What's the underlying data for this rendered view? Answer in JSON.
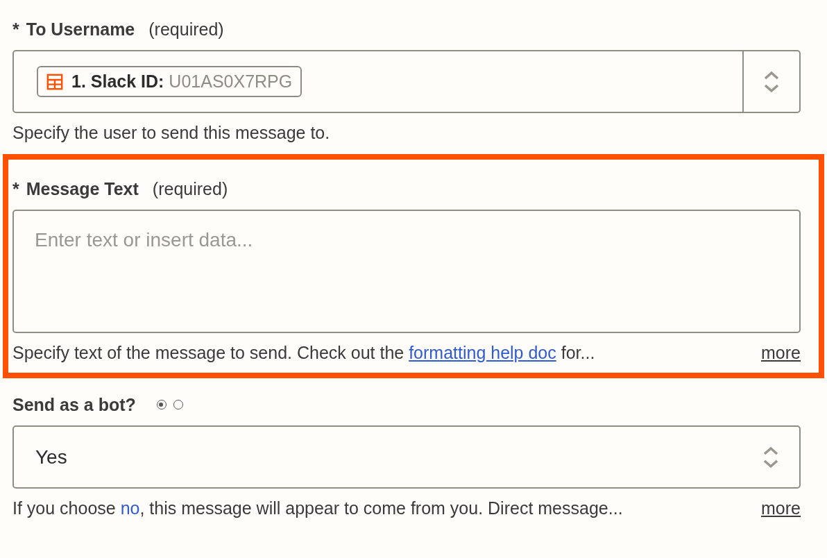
{
  "fields": [
    {
      "kind": "token-select",
      "mark": "*",
      "label": "To Username",
      "note": "(required)",
      "highlighted": false,
      "token": {
        "label": "1. Slack ID:",
        "value": "U01AS0X7RPG"
      },
      "help": {
        "before": "Specify the user to send this message to."
      }
    },
    {
      "kind": "textarea",
      "mark": "*",
      "label": "Message Text",
      "note": "(required)",
      "highlighted": true,
      "placeholder": "Enter text or insert data...",
      "help": {
        "before": "Specify text of the message to send. Check out the ",
        "link": "formatting help doc",
        "link_underlined": true,
        "after": " for...",
        "more": "more"
      }
    },
    {
      "kind": "select",
      "label": "Send as a bot?",
      "highlighted": false,
      "radios": [
        {
          "selected": true
        },
        {
          "selected": false
        }
      ],
      "value": "Yes",
      "help": {
        "before": "If you choose ",
        "link": "no",
        "link_underlined": false,
        "after": ", this message will appear to come from you. Direct message...",
        "more": "more"
      }
    }
  ]
}
